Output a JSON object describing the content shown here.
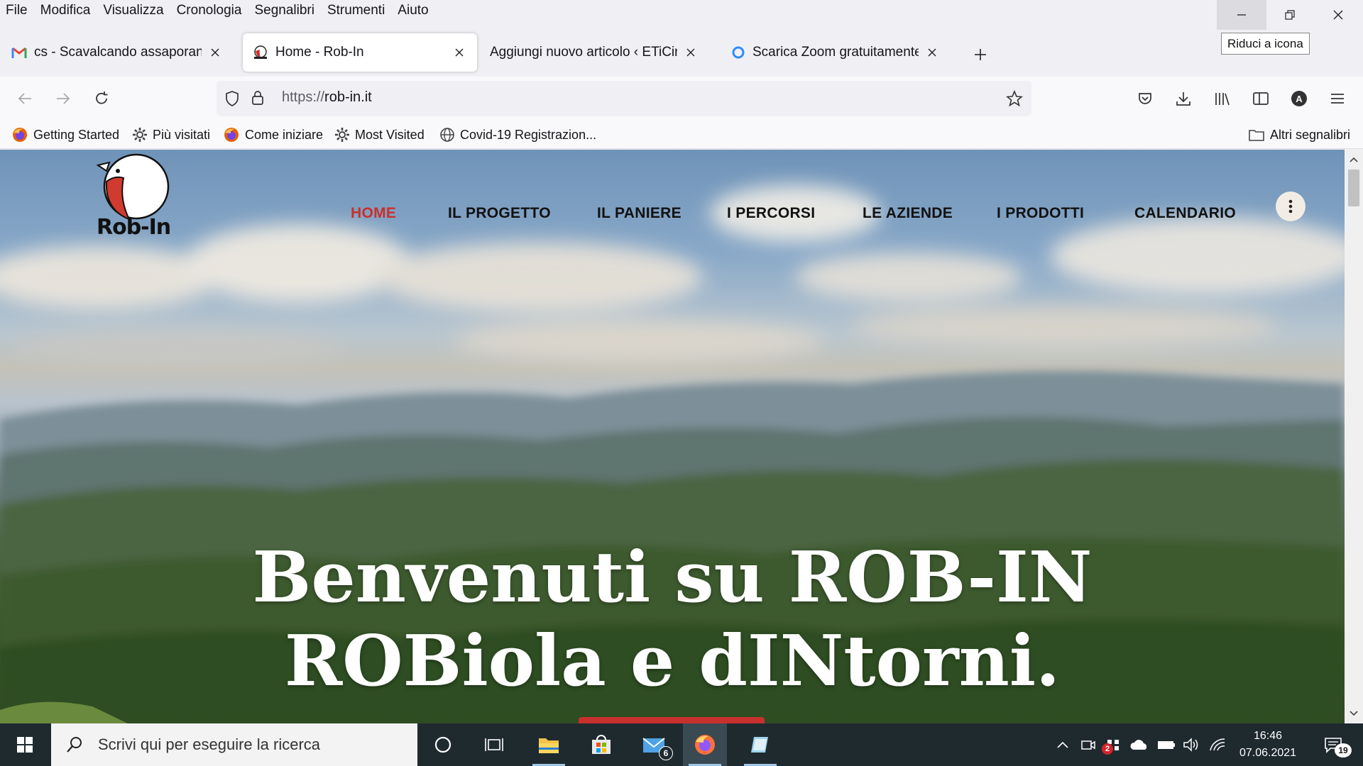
{
  "menubar": {
    "items": [
      "File",
      "Modifica",
      "Visualizza",
      "Cronologia",
      "Segnalibri",
      "Strumenti",
      "Aiuto"
    ]
  },
  "window": {
    "tooltip": "Riduci a icona"
  },
  "tabs": [
    {
      "title": "cs - Scavalcando assaporando -",
      "favicon": "gmail-icon"
    },
    {
      "title": "Home - Rob-In",
      "favicon": "robin-icon",
      "active": true
    },
    {
      "title": "Aggiungi nuovo articolo ‹ ETiCinforma",
      "favicon": "none"
    },
    {
      "title": "Scarica Zoom gratuitamente | Blog",
      "favicon": "zoom-icon"
    }
  ],
  "address": {
    "scheme": "https://",
    "host": "rob-in.it"
  },
  "bookmarks": [
    {
      "label": "Getting Started",
      "icon": "firefox-icon"
    },
    {
      "label": "Più visitati",
      "icon": "gear-icon"
    },
    {
      "label": "Come iniziare",
      "icon": "firefox-icon"
    },
    {
      "label": "Most Visited",
      "icon": "gear-icon"
    },
    {
      "label": "Covid-19 Registrazion...",
      "icon": "globe-icon"
    }
  ],
  "other_bookmarks": "Altri segnalibri",
  "site": {
    "logo_text": "Rob-In",
    "nav": [
      "HOME",
      "IL PROGETTO",
      "IL PANIERE",
      "I PERCORSI",
      "LE AZIENDE",
      "I PRODOTTI",
      "CALENDARIO"
    ],
    "hero_line1": "Benvenuti su ROB-IN",
    "hero_line2": "ROBiola e dINtorni.",
    "accent": "#c8302e"
  },
  "taskbar": {
    "search_placeholder": "Scrivi qui per eseguire la ricerca",
    "mail_badge": "6",
    "tray_badge": "2",
    "time": "16:46",
    "date": "07.06.2021",
    "notifications": "19"
  }
}
